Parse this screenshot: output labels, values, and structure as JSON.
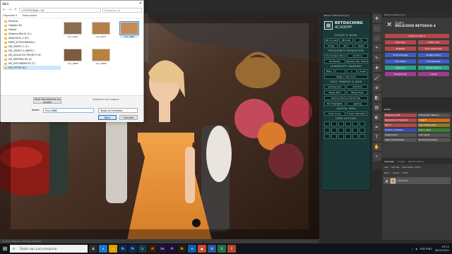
{
  "dialog": {
    "title": "Abrir",
    "address_path": "« FOTOS Bold › 04",
    "search_placeholder": "Pesquisar 04",
    "organize_label": "Organizar ▾",
    "new_folder_label": "Nova pasta",
    "sidebar_items": [
      "Músicas",
      "Objetos 3D",
      "Vídeos",
      "Sistema Win10 (C:)",
      "ARQUIVOS_1 (D:)",
      "PARQ_B PROGRAMAS (",
      "HD_GRUPO 1 (F:)",
      "HD_GRUPO 2 (WEFS:)",
      "HD_AULAS DO PROJETO (H:",
      "HD_MATERIA ML (I:)",
      "HD_DOCUMENTOS (T:)",
      "HD_FOTOS (K:)"
    ],
    "files": [
      {
        "name": "YLA_0146",
        "color": "#8a6c4f"
      },
      {
        "name": "YLA_0227",
        "color": "#b57f45"
      },
      {
        "name": "YLA_0682",
        "color": "#c58b56",
        "selected": true
      },
      {
        "name": "YLA_0808",
        "color": "#7d5b3e"
      },
      {
        "name": "YLA_0906",
        "color": "#b8823d"
      }
    ],
    "open_docs_button": "Abrir documentos no nuvem",
    "file_name_label": "Nome:",
    "file_name_value": "YLA_0682",
    "file_type_value": "Todos os Formatos",
    "sequence_label": "Sequência de Imagens",
    "open_button": "Abrir",
    "cancel_button": "Cancelar"
  },
  "ra_panel": {
    "header": "BEAUTY RETOUCH v2.6",
    "logo_line1": "RETOUCHING",
    "logo_line2": "ACADEMY",
    "sections": [
      {
        "title": "DODGE & BURN",
        "rows": [
          [
            "DB Curves",
            "DB Solid",
            "Fix"
          ],
          [
            "Dodge",
            "Burn",
            "Reset"
          ]
        ]
      },
      {
        "title": "FREQUENCY SEPARATION",
        "rows": [
          [
            "Via Occasion Blur",
            "Combine"
          ],
          [
            "Via Median",
            "Quality Skin Texture"
          ]
        ]
      },
      {
        "title": "LUMINOSITY MASKING",
        "rows": [
          [
            "Basic",
            "-",
            "+",
            "Invert"
          ],
          [
            "Midgt or Skin Tone"
          ]
        ]
      },
      {
        "title": "FACE, MAKEUP & HAIR",
        "rows": [
          [
            "Glowing Skin",
            "Anti-Pink"
          ],
          [
            "Neugs Bars",
            "Neugs Eyes"
          ],
          [
            "Remove Shiny & Facial Hair"
          ],
          [
            "Hair Highlights",
            "Lighting"
          ]
        ]
      },
      {
        "title": "DIGITAL SKIN",
        "rows": [
          [
            "Solar Curve",
            "Clean Saturation"
          ]
        ]
      },
      {
        "title": "USER ACTIONS",
        "rows": []
      }
    ]
  },
  "dr_panel": {
    "header": "Delicious Retouch 4",
    "logo_line1": "Conf's",
    "logo_line2": "DELICIOUS RETOUCH 4",
    "rows": [
      [
        {
          "label": "Delicious Skin 4",
          "color": "#b5474a"
        }
      ],
      [
        {
          "label": "Heal Skin",
          "color": "#b5474a"
        },
        {
          "label": "Soften Skin",
          "color": "#b5474a"
        }
      ],
      [
        {
          "label": "Brighten",
          "color": "#b5474a"
        },
        {
          "label": "Freq. Separation",
          "color": "#b5474a"
        }
      ],
      [
        {
          "label": "Tone Changes",
          "color": "#3b5fc9"
        },
        {
          "label": "Dodge & Burn",
          "color": "#3b5fc9"
        }
      ],
      [
        {
          "label": "Skin Mask",
          "color": "#3b5fc9"
        },
        {
          "label": "Portrait Mask",
          "color": "#3b5fc9"
        }
      ],
      [
        {
          "label": "Eyes Glo",
          "color": "#2aa399"
        },
        {
          "label": "White Balance",
          "color": "#2aa399"
        }
      ],
      [
        {
          "label": "Sharpening",
          "color": "#9b3e8c"
        },
        {
          "label": "Liquify",
          "color": "#9b3e8c"
        }
      ]
    ]
  },
  "actions_panel": {
    "tab": "Ações",
    "rows": [
      [
        {
          "label": "Frequency 2 Diff",
          "color": "#b5474a"
        },
        {
          "label": "Ultimate Skin Retouch",
          "color": "#565656"
        }
      ],
      [
        {
          "label": "Separação de Frequência",
          "color": "#b5474a"
        },
        {
          "label": "Dodge P",
          "color": "#d56b1f"
        }
      ],
      [
        {
          "label": "Burn P",
          "color": "#b5474a"
        },
        {
          "label": "Clean Teeth & Eyes",
          "color": "#8a7d1d"
        }
      ],
      [
        {
          "label": "Fix Blue in Shadows",
          "color": "#3a4db5"
        },
        {
          "label": "Glow + redos",
          "color": "#3b7d35"
        }
      ],
      [
        {
          "label": "Dodge & Burn",
          "color": "#565656"
        },
        {
          "label": "Color Adjust",
          "color": "#565656"
        }
      ],
      [
        {
          "label": "Light (Luminosidade)",
          "color": "#565656"
        },
        {
          "label": "Normal (Luminosity)",
          "color": "#565656"
        }
      ]
    ]
  },
  "layers_panel": {
    "tabs": [
      "Camadas",
      "Canais",
      "Demarcadores"
    ],
    "kind_label": "Tipo",
    "blend_mode": "Normal",
    "opacity_label": "Opacidade: 100%",
    "lock_label": "Bloq.:",
    "fill_label": "Preenc.: 100%",
    "layer_name": "Camada 0"
  },
  "status_bar": {
    "text": "33,33%    7360 px x 4912 px (300 ppi)"
  },
  "taskbar": {
    "search_placeholder": "Digite aqui para pesquisar",
    "apps": [
      {
        "label": "⧉",
        "color": "#2d2d2d"
      },
      {
        "label": "e",
        "color": "#1a74d0"
      },
      {
        "label": "▭",
        "color": "#e0a200"
      },
      {
        "label": "Ps",
        "color": "#0a2a54"
      },
      {
        "label": "Ps",
        "color": "#0a2a54"
      },
      {
        "label": "Lr",
        "color": "#1a3447"
      },
      {
        "label": "Ai",
        "color": "#3a1a05"
      },
      {
        "label": "Ae",
        "color": "#22103f"
      },
      {
        "label": "Pr",
        "color": "#1c0d38"
      },
      {
        "label": "Br",
        "color": "#2c1a08"
      },
      {
        "label": "✉",
        "color": "#0b5cad"
      },
      {
        "label": "●",
        "color": "#d14b2a"
      },
      {
        "label": "W",
        "color": "#2b579a"
      },
      {
        "label": "X",
        "color": "#217346"
      },
      {
        "label": "P",
        "color": "#b7472a"
      }
    ],
    "time": "09:12",
    "date": "28/01/2021",
    "lang": "POR PTB2"
  }
}
